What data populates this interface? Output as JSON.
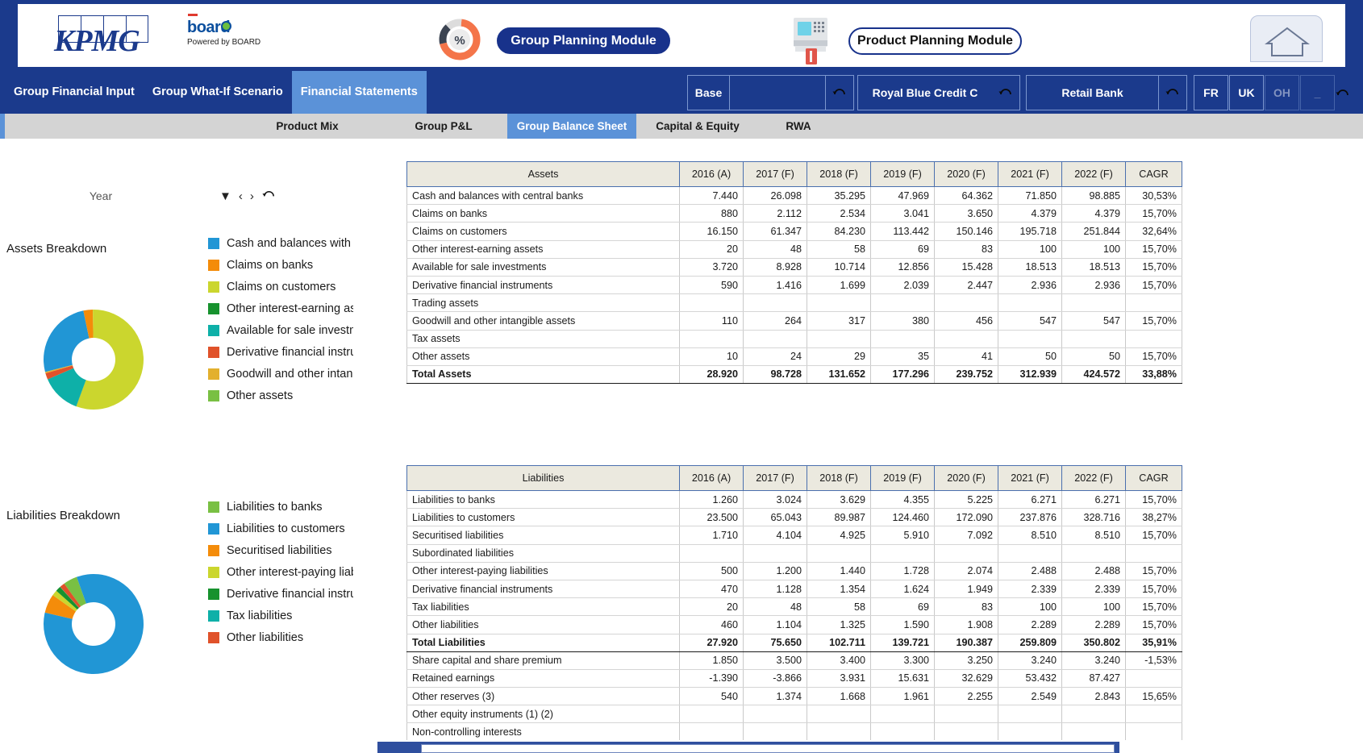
{
  "header": {
    "kpmg_logo_text": "KPMG",
    "board_logo_text": "board",
    "board_logo_sub": "Powered by BOARD",
    "percent_icon_label": "%",
    "group_planning_module": "Group Planning Module",
    "product_planning_module": "Product  Planning Module",
    "atm_icon_name": "atm-icon",
    "home_icon_name": "home-icon"
  },
  "nav": {
    "tabs": [
      {
        "label": "Group Financial Input",
        "active": false
      },
      {
        "label": "Group What-If Scenario",
        "active": false
      },
      {
        "label": "Financial Statements",
        "active": true
      }
    ],
    "selectors": {
      "scenario_label": "Base",
      "scenario_value": "",
      "entity_label": "",
      "entity_value": "Royal Blue Credit C",
      "bank_label": "",
      "bank_value": "Retail Bank",
      "country_fr": "FR",
      "country_uk": "UK",
      "country_oh": "OH",
      "country_blank": "_",
      "refresh_icon_name": "refresh-icon"
    }
  },
  "sub_nav": {
    "tabs": [
      {
        "label": "Product Mix",
        "active": false
      },
      {
        "label": "Group P&L",
        "active": false
      },
      {
        "label": "Group Balance Sheet",
        "active": true
      },
      {
        "label": "Capital & Equity",
        "active": false
      },
      {
        "label": "RWA",
        "active": false
      }
    ]
  },
  "left_panel": {
    "year_label": "Year",
    "controls": {
      "dropdown_icon": "▼",
      "prev_icon": "‹",
      "next_icon": "›",
      "refresh_icon_name": "refresh-icon"
    },
    "assets_breakdown_title": "Assets Breakdown",
    "liabilities_breakdown_title": "Liabilities Breakdown"
  },
  "chart_data": [
    {
      "type": "pie",
      "title": "Assets Breakdown",
      "legend_position": "right",
      "categories": [
        "Cash and balances with ce",
        "Claims on banks",
        "Claims on customers",
        "Other interest-earning ass",
        "Available for sale investm",
        "Derivative financial instru",
        "Goodwill and other intang",
        "Other assets"
      ],
      "values": [
        7.44,
        0.88,
        16.15,
        0.02,
        3.72,
        0.59,
        0.11,
        0.01
      ],
      "colors": [
        "#2196d5",
        "#f48c0a",
        "#cbd62e",
        "#17922e",
        "#0eb0a8",
        "#e0522a",
        "#e3b02e",
        "#79c043"
      ]
    },
    {
      "type": "pie",
      "title": "Liabilities Breakdown",
      "legend_position": "right",
      "categories": [
        "Liabilities to banks",
        "Liabilities to customers",
        "Securitised liabilities",
        "Other interest-paying liab",
        "Derivative financial instru",
        "Tax liabilities",
        "Other liabilities"
      ],
      "values": [
        1.26,
        23.5,
        1.71,
        0.5,
        0.47,
        0.02,
        0.46
      ],
      "colors": [
        "#79c043",
        "#2196d5",
        "#f48c0a",
        "#cbd62e",
        "#17922e",
        "#0eb0a8",
        "#e0522a"
      ]
    }
  ],
  "assets_table": {
    "headers": [
      "Assets",
      "2016 (A)",
      "2017 (F)",
      "2018 (F)",
      "2019 (F)",
      "2020 (F)",
      "2021 (F)",
      "2022 (F)",
      "CAGR"
    ],
    "rows": [
      {
        "label": "Cash and balances with central banks",
        "values": [
          "7.440",
          "26.098",
          "35.295",
          "47.969",
          "64.362",
          "71.850",
          "98.885"
        ],
        "cagr": "30,53%",
        "total": false
      },
      {
        "label": "Claims on banks",
        "values": [
          "880",
          "2.112",
          "2.534",
          "3.041",
          "3.650",
          "4.379",
          "4.379"
        ],
        "cagr": "15,70%",
        "total": false
      },
      {
        "label": "Claims on customers",
        "values": [
          "16.150",
          "61.347",
          "84.230",
          "113.442",
          "150.146",
          "195.718",
          "251.844"
        ],
        "cagr": "32,64%",
        "total": false
      },
      {
        "label": "Other interest-earning assets",
        "values": [
          "20",
          "48",
          "58",
          "69",
          "83",
          "100",
          "100"
        ],
        "cagr": "15,70%",
        "total": false
      },
      {
        "label": "Available for sale investments",
        "values": [
          "3.720",
          "8.928",
          "10.714",
          "12.856",
          "15.428",
          "18.513",
          "18.513"
        ],
        "cagr": "15,70%",
        "total": false
      },
      {
        "label": "Derivative financial instruments",
        "values": [
          "590",
          "1.416",
          "1.699",
          "2.039",
          "2.447",
          "2.936",
          "2.936"
        ],
        "cagr": "15,70%",
        "total": false
      },
      {
        "label": "Trading assets",
        "values": [
          "",
          "",
          "",
          "",
          "",
          "",
          ""
        ],
        "cagr": "",
        "total": false
      },
      {
        "label": "Goodwill and other intangible assets",
        "values": [
          "110",
          "264",
          "317",
          "380",
          "456",
          "547",
          "547"
        ],
        "cagr": "15,70%",
        "total": false
      },
      {
        "label": "Tax assets",
        "values": [
          "",
          "",
          "",
          "",
          "",
          "",
          ""
        ],
        "cagr": "",
        "total": false
      },
      {
        "label": "Other assets",
        "values": [
          "10",
          "24",
          "29",
          "35",
          "41",
          "50",
          "50"
        ],
        "cagr": "15,70%",
        "total": false
      },
      {
        "label": "Total Assets",
        "values": [
          "28.920",
          "98.728",
          "131.652",
          "177.296",
          "239.752",
          "312.939",
          "424.572"
        ],
        "cagr": "33,88%",
        "total": true
      }
    ]
  },
  "liabilities_table": {
    "headers": [
      "Liabilities",
      "2016 (A)",
      "2017 (F)",
      "2018 (F)",
      "2019 (F)",
      "2020 (F)",
      "2021 (F)",
      "2022 (F)",
      "CAGR"
    ],
    "rows": [
      {
        "label": "Liabilities to banks",
        "values": [
          "1.260",
          "3.024",
          "3.629",
          "4.355",
          "5.225",
          "6.271",
          "6.271"
        ],
        "cagr": "15,70%",
        "total": false
      },
      {
        "label": "Liabilities to customers",
        "values": [
          "23.500",
          "65.043",
          "89.987",
          "124.460",
          "172.090",
          "237.876",
          "328.716"
        ],
        "cagr": "38,27%",
        "total": false
      },
      {
        "label": "Securitised liabilities",
        "values": [
          "1.710",
          "4.104",
          "4.925",
          "5.910",
          "7.092",
          "8.510",
          "8.510"
        ],
        "cagr": "15,70%",
        "total": false
      },
      {
        "label": "Subordinated liabilities",
        "values": [
          "",
          "",
          "",
          "",
          "",
          "",
          ""
        ],
        "cagr": "",
        "total": false
      },
      {
        "label": "Other interest-paying liabilities",
        "values": [
          "500",
          "1.200",
          "1.440",
          "1.728",
          "2.074",
          "2.488",
          "2.488"
        ],
        "cagr": "15,70%",
        "total": false
      },
      {
        "label": "Derivative financial instruments",
        "values": [
          "470",
          "1.128",
          "1.354",
          "1.624",
          "1.949",
          "2.339",
          "2.339"
        ],
        "cagr": "15,70%",
        "total": false
      },
      {
        "label": "Tax liabilities",
        "values": [
          "20",
          "48",
          "58",
          "69",
          "83",
          "100",
          "100"
        ],
        "cagr": "15,70%",
        "total": false
      },
      {
        "label": "Other liabilities",
        "values": [
          "460",
          "1.104",
          "1.325",
          "1.590",
          "1.908",
          "2.289",
          "2.289"
        ],
        "cagr": "15,70%",
        "total": false
      },
      {
        "label": "Total Liabilities",
        "values": [
          "27.920",
          "75.650",
          "102.711",
          "139.721",
          "190.387",
          "259.809",
          "350.802"
        ],
        "cagr": "35,91%",
        "total": true
      },
      {
        "label": "Share capital and share premium",
        "values": [
          "1.850",
          "3.500",
          "3.400",
          "3.300",
          "3.250",
          "3.240",
          "3.240"
        ],
        "cagr": "-1,53%",
        "total": false
      },
      {
        "label": "Retained earnings",
        "values": [
          "-1.390",
          "-3.866",
          "3.931",
          "15.631",
          "32.629",
          "53.432",
          "87.427"
        ],
        "cagr": "",
        "total": false
      },
      {
        "label": "Other reserves (3)",
        "values": [
          "540",
          "1.374",
          "1.668",
          "1.961",
          "2.255",
          "2.549",
          "2.843"
        ],
        "cagr": "15,65%",
        "total": false
      },
      {
        "label": "Other equity instruments (1) (2)",
        "values": [
          "",
          "",
          "",
          "",
          "",
          "",
          ""
        ],
        "cagr": "",
        "total": false
      },
      {
        "label": "Non-controlling interests",
        "values": [
          "",
          "",
          "",
          "",
          "",
          "",
          ""
        ],
        "cagr": "",
        "total": false
      }
    ]
  },
  "colors": {
    "brand_blue": "#1b3a8c",
    "accent_blue": "#5b92d8",
    "cyan": "#29abe2",
    "table_header": "#ebe9df",
    "subnav_grey": "#d4d4d4"
  }
}
